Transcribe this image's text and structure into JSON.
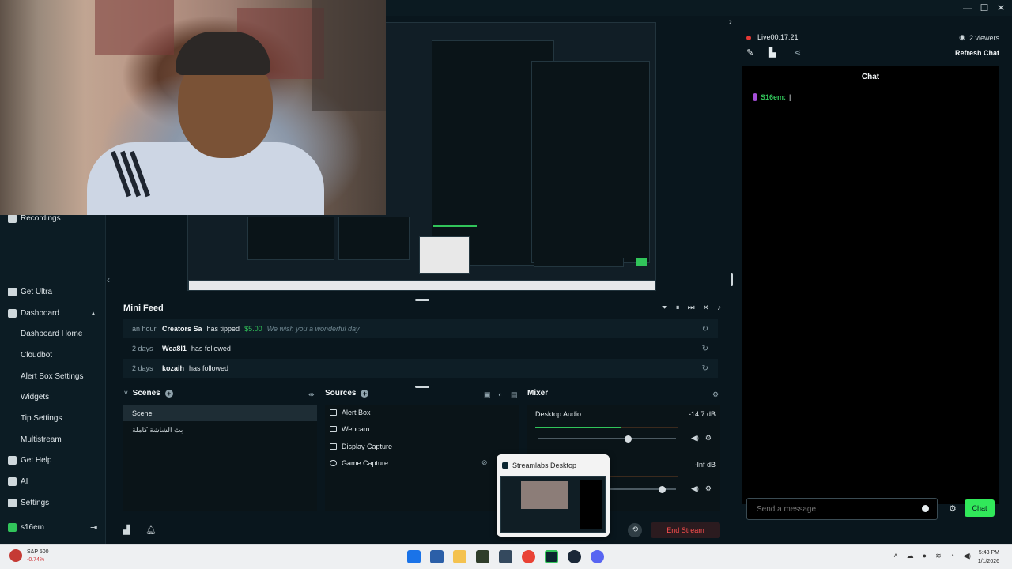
{
  "window": {
    "minimize": "—",
    "maximize": "☐",
    "close": "✕"
  },
  "sidebar": {
    "items": [
      {
        "label": "Recordings",
        "icon": "recordings-icon"
      },
      {
        "label": "Get Ultra",
        "icon": "ultra-icon"
      },
      {
        "label": "Dashboard",
        "icon": "dashboard-icon"
      },
      {
        "label": "Dashboard Home"
      },
      {
        "label": "Cloudbot"
      },
      {
        "label": "Alert Box Settings"
      },
      {
        "label": "Widgets"
      },
      {
        "label": "Tip Settings"
      },
      {
        "label": "Multistream"
      },
      {
        "label": "Get Help",
        "icon": "help-icon"
      },
      {
        "label": "AI",
        "icon": "ai-icon"
      },
      {
        "label": "Settings",
        "icon": "gear-icon"
      }
    ],
    "user": "s16em",
    "dashboard_caret": "▲"
  },
  "minifeed": {
    "title": "Mini Feed",
    "rows": [
      {
        "time": "an hour",
        "name": "Creators Sa",
        "action": "has tipped",
        "amount": "$5.00",
        "message": "We wish you a wonderful day"
      },
      {
        "time": "2 days",
        "name": "Wea8l1",
        "action": "has followed"
      },
      {
        "time": "2 days",
        "name": "kozaih",
        "action": "has followed"
      }
    ]
  },
  "scenes": {
    "title": "Scenes",
    "items": [
      "Scene",
      "بث الشاشة كاملة"
    ]
  },
  "sources": {
    "title": "Sources",
    "items": [
      "Alert Box",
      "Webcam",
      "Display Capture",
      "Game Capture"
    ]
  },
  "mixer": {
    "title": "Mixer",
    "channels": [
      {
        "name": "Desktop Audio",
        "db": "-14.7 dB",
        "level": 0.6,
        "volume": 0.65
      },
      {
        "name": "",
        "db": "-Inf dB",
        "level": 0,
        "volume": 0.9
      }
    ]
  },
  "controls": {
    "end_stream": "End Stream"
  },
  "thumbnail": {
    "title": "Streamlabs Desktop"
  },
  "chat": {
    "live_label": "Live",
    "live_time": "00:17:21",
    "viewers": "2 viewers",
    "refresh": "Refresh Chat",
    "title": "Chat",
    "messages": [
      {
        "user": "S16em:",
        "text": "|"
      }
    ],
    "input_placeholder": "Send a message",
    "send": "Chat"
  },
  "taskbar": {
    "stock_name": "S&P 500",
    "stock_change": "-0.74%",
    "time": "5:43 PM",
    "date": "1/1/2026",
    "apps": [
      "windows-start-icon",
      "task-view-icon",
      "file-explorer-icon",
      "android-studio-icon",
      "app-icon",
      "chrome-icon",
      "streamlabs-icon",
      "steam-icon",
      "discord-icon"
    ]
  }
}
